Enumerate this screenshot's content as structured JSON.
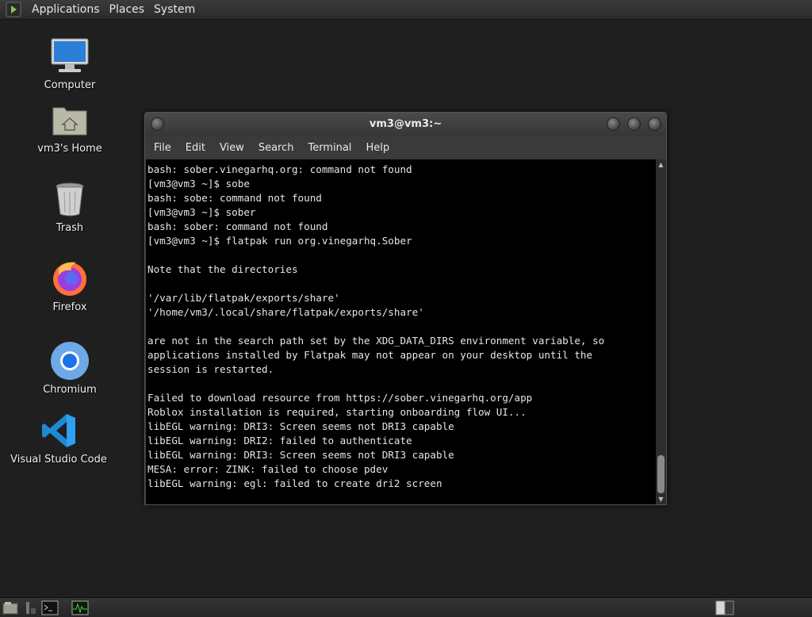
{
  "top_panel": {
    "menus": [
      "Applications",
      "Places",
      "System"
    ]
  },
  "desktop": {
    "icons": [
      {
        "label": "Computer",
        "icon": "computer-icon"
      },
      {
        "label": "vm3's Home",
        "icon": "home-folder-icon"
      },
      {
        "label": "Trash",
        "icon": "trash-icon"
      },
      {
        "label": "Firefox",
        "icon": "firefox-icon"
      },
      {
        "label": "Chromium",
        "icon": "chromium-icon"
      },
      {
        "label": "Visual Studio Code",
        "icon": "vscode-icon"
      }
    ]
  },
  "terminal": {
    "title": "vm3@vm3:~",
    "menu": [
      "File",
      "Edit",
      "View",
      "Search",
      "Terminal",
      "Help"
    ],
    "lines": [
      "bash: sober.vinegarhq.org: command not found",
      "[vm3@vm3 ~]$ sobe",
      "bash: sobe: command not found",
      "[vm3@vm3 ~]$ sober",
      "bash: sober: command not found",
      "[vm3@vm3 ~]$ flatpak run org.vinegarhq.Sober",
      "",
      "Note that the directories",
      "",
      "'/var/lib/flatpak/exports/share'",
      "'/home/vm3/.local/share/flatpak/exports/share'",
      "",
      "are not in the search path set by the XDG_DATA_DIRS environment variable, so",
      "applications installed by Flatpak may not appear on your desktop until the",
      "session is restarted.",
      "",
      "Failed to download resource from https://sober.vinegarhq.org/app",
      "Roblox installation is required, starting onboarding flow UI...",
      "libEGL warning: DRI3: Screen seems not DRI3 capable",
      "libEGL warning: DRI2: failed to authenticate",
      "libEGL warning: DRI3: Screen seems not DRI3 capable",
      "MESA: error: ZINK: failed to choose pdev",
      "libEGL warning: egl: failed to create dri2 screen"
    ]
  },
  "colors": {
    "desktop_bg": "#1f1f1f",
    "terminal_bg": "#000000",
    "terminal_fg": "#e6e6e6"
  }
}
